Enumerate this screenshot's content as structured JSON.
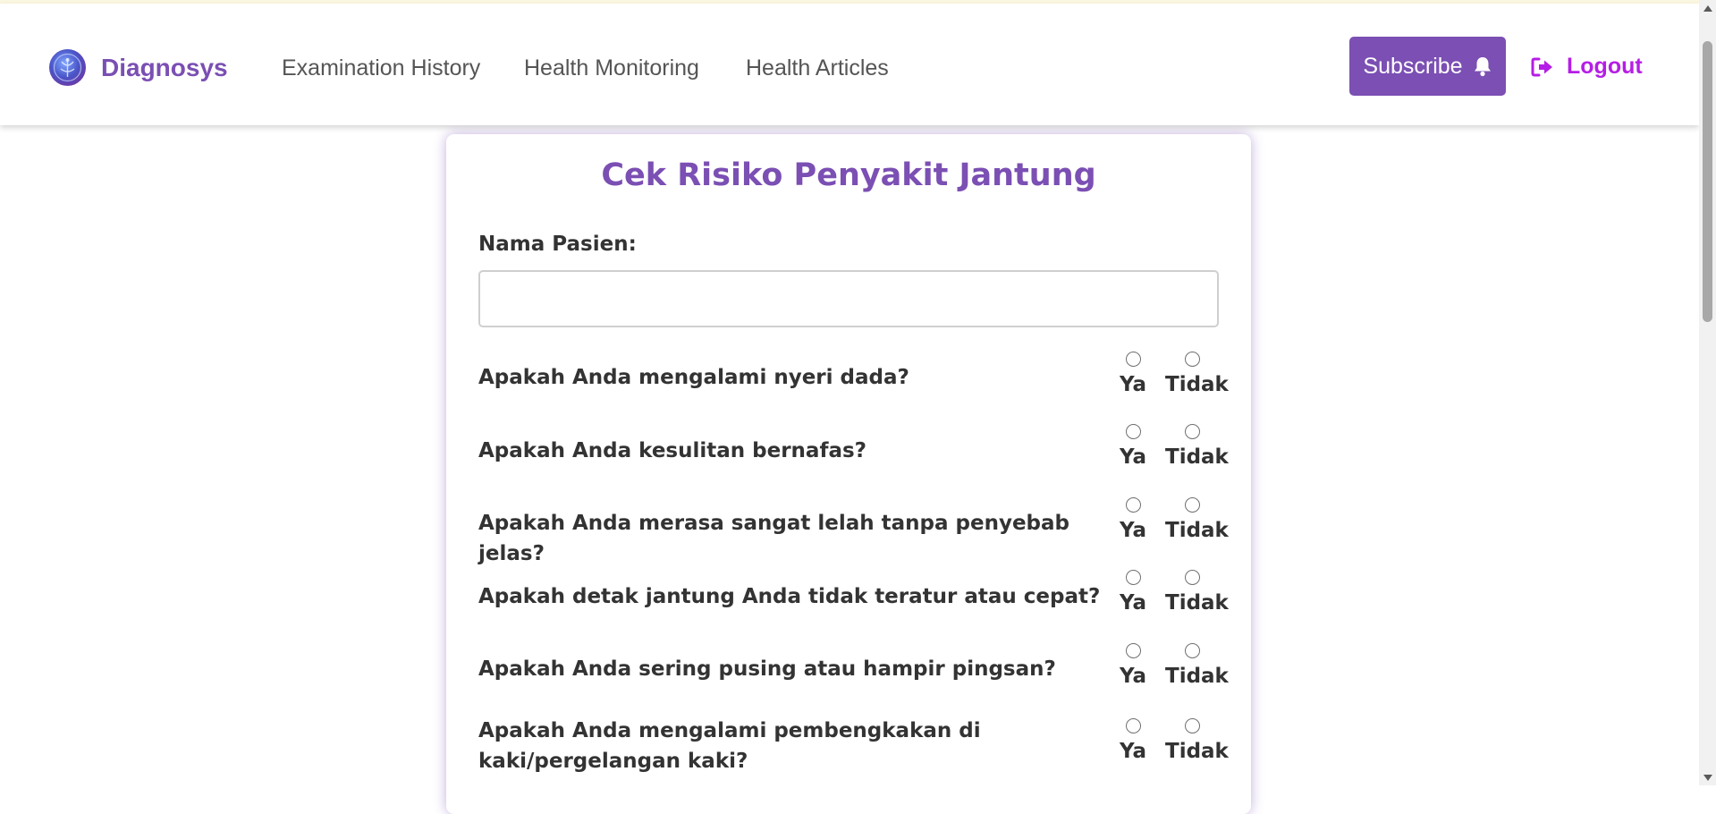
{
  "navbar": {
    "brand": "Diagnosys",
    "links": [
      "Examination History",
      "Health Monitoring",
      "Health Articles"
    ],
    "subscribe_label": "Subscribe",
    "logout_label": "Logout"
  },
  "form": {
    "title": "Cek Risiko Penyakit Jantung",
    "name_label": "Nama Pasien:",
    "name_value": "",
    "option_yes": "Ya",
    "option_no": "Tidak",
    "questions": [
      "Apakah Anda mengalami nyeri dada?",
      "Apakah Anda kesulitan bernafas?",
      "Apakah Anda merasa sangat lelah tanpa penyebab jelas?",
      "Apakah detak jantung Anda tidak teratur atau cepat?",
      "Apakah Anda sering pusing atau hampir pingsan?",
      "Apakah Anda mengalami pembengkakan di kaki/pergelangan kaki?"
    ]
  },
  "colors": {
    "brand_purple": "#7b4fb3",
    "logout_magenta": "#b51ee6"
  }
}
